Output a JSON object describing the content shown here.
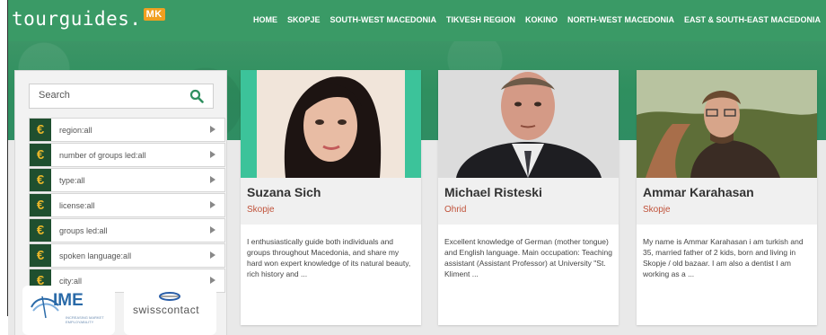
{
  "site": {
    "logo_text": "tourguides.",
    "logo_badge": "MK"
  },
  "nav": {
    "items": [
      "HOME",
      "SKOPJE",
      "SOUTH-WEST MACEDONIA",
      "TIKVESH REGION",
      "KOKINO",
      "NORTH-WEST MACEDONIA",
      "EAST & SOUTH-EAST MACEDONIA"
    ]
  },
  "search": {
    "placeholder": "Search"
  },
  "filters": [
    {
      "label": "region:all",
      "icon": "euro-icon"
    },
    {
      "label": "number of groups led:all",
      "icon": "euro-icon"
    },
    {
      "label": "type:all",
      "icon": "euro-icon"
    },
    {
      "label": "license:all",
      "icon": "euro-icon"
    },
    {
      "label": "groups led:all",
      "icon": "euro-icon"
    },
    {
      "label": "spoken language:all",
      "icon": "euro-icon"
    },
    {
      "label": "city:all",
      "icon": "euro-icon"
    }
  ],
  "filter_icon_glyph": "€",
  "sponsors": {
    "ime": {
      "name": "IME",
      "tagline": "INCREASING MARKET EMPLOYABILITY"
    },
    "swiss": {
      "name": "swisscontact"
    }
  },
  "guides": [
    {
      "name": "Suzana Sich",
      "city": "Skopje",
      "description": "I enthusiastically guide both individuals and groups throughout Macedonia, and share my hard won expert knowledge of its natural beauty, rich history and ..."
    },
    {
      "name": "Michael Risteski",
      "city": "Ohrid",
      "description": "Excellent knowledge of German (mother tongue) and English language. Main occupation: Teaching assistant (Assistant Professor) at University \"St. Kliment ..."
    },
    {
      "name": "Ammar Karahasan",
      "city": "Skopje",
      "description": "My name is Ammar Karahasan i am turkish and 35, married father of 2 kids, born and living in Skopje / old bazaar. I am also a dentist I am working as a ..."
    }
  ],
  "colors": {
    "brand_green": "#3a9a66",
    "filter_icon_bg": "#1f4f2f",
    "filter_icon_fg": "#e8b62a",
    "city_text": "#c0523a",
    "logo_badge": "#f0a020"
  }
}
